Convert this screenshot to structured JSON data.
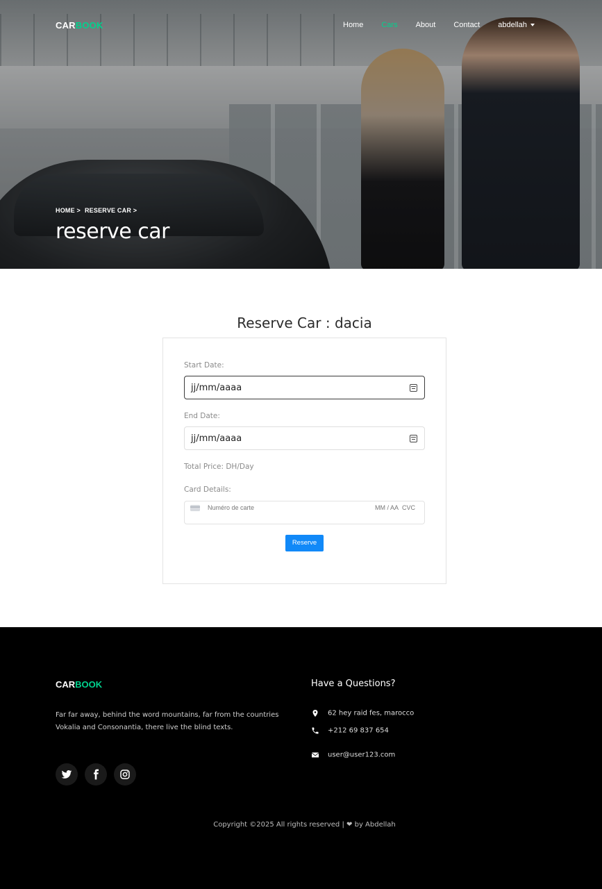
{
  "nav": {
    "brand_part1": "CAR",
    "brand_part2": "BOOK",
    "items": [
      {
        "label": "Home"
      },
      {
        "label": "Cars",
        "active": true
      },
      {
        "label": "About"
      },
      {
        "label": "Contact"
      }
    ],
    "user": "abdellah"
  },
  "hero": {
    "breadcrumb": [
      "HOME >",
      "RESERVE CAR >"
    ],
    "title": "reserve car"
  },
  "reserve": {
    "heading": "Reserve Car : dacia",
    "start_label": "Start Date:",
    "start_value": "jj/mm/aaaa",
    "end_label": "End Date:",
    "end_value": "jj/mm/aaaa",
    "total_price": "Total Price: DH/Day",
    "card_label": "Card Details:",
    "card_number_placeholder": "Numéro de carte",
    "card_expiry_placeholder": "MM / AA",
    "card_cvc_placeholder": "CVC",
    "button": "Reserve"
  },
  "footer": {
    "brand_part1": "CAR",
    "brand_part2": "BOOK",
    "about": "Far far away, behind the word mountains, far from the countries Vokalia and Consonantia, there live the blind texts.",
    "questions_heading": "Have a Questions?",
    "address": "62 hey raid fes, marocco",
    "phone": "+212 69 837 654",
    "email": "user@user123.com",
    "copyright_before": "Copyright ©2025 All rights reserved |",
    "copyright_after": "by Abdellah"
  },
  "colors": {
    "accent": "#01d28e",
    "button": "#1189f8",
    "footer_bg": "#000000"
  }
}
